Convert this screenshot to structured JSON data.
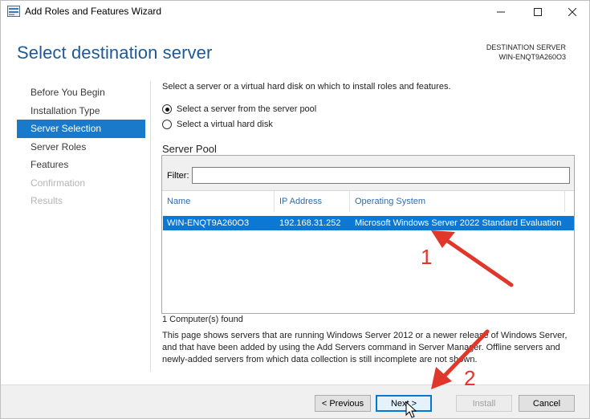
{
  "window": {
    "title": "Add Roles and Features Wizard"
  },
  "header": {
    "page_title": "Select destination server",
    "destination_label": "DESTINATION SERVER",
    "destination_value": "WIN-ENQT9A260O3"
  },
  "nav": {
    "items": [
      {
        "label": "Before You Begin",
        "state": "normal"
      },
      {
        "label": "Installation Type",
        "state": "normal"
      },
      {
        "label": "Server Selection",
        "state": "active"
      },
      {
        "label": "Server Roles",
        "state": "normal"
      },
      {
        "label": "Features",
        "state": "normal"
      },
      {
        "label": "Confirmation",
        "state": "disabled"
      },
      {
        "label": "Results",
        "state": "disabled"
      }
    ]
  },
  "content": {
    "instruction": "Select a server or a virtual hard disk on which to install roles and features.",
    "radio_pool": "Select a server from the server pool",
    "radio_vhd": "Select a virtual hard disk",
    "pool_label": "Server Pool",
    "filter_label": "Filter:",
    "filter_value": "",
    "columns": {
      "name": "Name",
      "ip": "IP Address",
      "os": "Operating System"
    },
    "rows": [
      {
        "name": "WIN-ENQT9A260O3",
        "ip": "192.168.31.252",
        "os": "Microsoft Windows Server 2022 Standard Evaluation"
      }
    ],
    "found": "1 Computer(s) found",
    "description": "This page shows servers that are running Windows Server 2012 or a newer release of Windows Server, and that have been added by using the Add Servers command in Server Manager. Offline servers and newly-added servers from which data collection is still incomplete are not shown."
  },
  "footer": {
    "previous": "< Previous",
    "next": "Next >",
    "install": "Install",
    "cancel": "Cancel"
  },
  "annotations": {
    "label_1": "1",
    "label_2": "2",
    "arrow_color": "#e0372a"
  },
  "colors": {
    "accent": "#1979ca",
    "title": "#1e5a96",
    "selection": "#0a78d4"
  }
}
